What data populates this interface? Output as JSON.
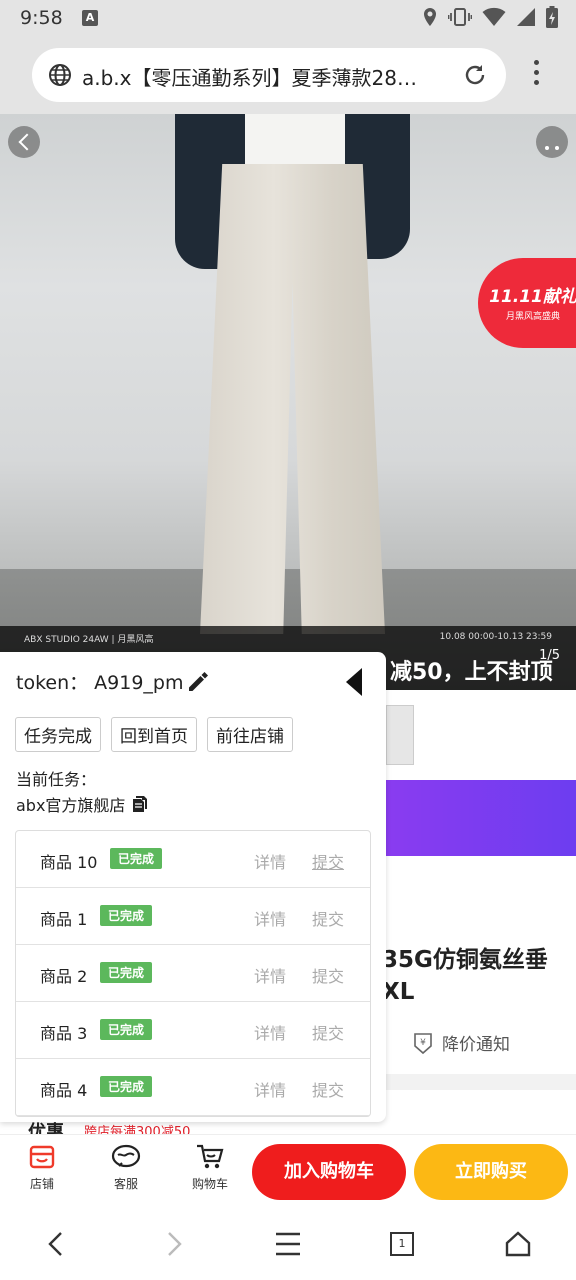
{
  "status_bar": {
    "time": "9:58",
    "a_badge": "A"
  },
  "browser": {
    "url": "a.b.x【零压通勤系列】夏季薄款28…"
  },
  "hero": {
    "strip_left": "ABX STUDIO 24AW   |   月黑风高",
    "strip_right": "10.08 00:00-10.13 23:59",
    "promo_text": "减50，上不封顶",
    "page_indicator": "1/5",
    "badge_title": "11.11献礼",
    "badge_sub": "月黑风高盛典"
  },
  "product": {
    "title_line1": "35G仿铜氨丝垂",
    "title_line2": "XL",
    "price_notify": "降价通知",
    "discount_label": "优惠",
    "discount_tag": "跨店每满300减50"
  },
  "panel": {
    "token_label": "token：",
    "token_value": "A919_pm",
    "buttons": [
      "任务完成",
      "回到首页",
      "前往店铺"
    ],
    "task_label": "当前任务：",
    "shop_name": "abx官方旗舰店",
    "items": [
      {
        "name": "商品 10",
        "status": "已完成",
        "detail": "详情",
        "submit": "提交"
      },
      {
        "name": "商品 1",
        "status": "已完成",
        "detail": "详情",
        "submit": "提交"
      },
      {
        "name": "商品 2",
        "status": "已完成",
        "detail": "详情",
        "submit": "提交"
      },
      {
        "name": "商品 3",
        "status": "已完成",
        "detail": "详情",
        "submit": "提交"
      },
      {
        "name": "商品 4",
        "status": "已完成",
        "detail": "详情",
        "submit": "提交"
      }
    ]
  },
  "action_bar": {
    "shop": "店铺",
    "service": "客服",
    "cart": "购物车",
    "add_to_cart": "加入购物车",
    "buy_now": "立即购买"
  },
  "nav": {
    "tab_count": "1"
  },
  "colors": {
    "red": "#ef1d1d",
    "yellow": "#fcb814",
    "green_badge": "#5cb85c",
    "purple": "#7a3cf0"
  }
}
